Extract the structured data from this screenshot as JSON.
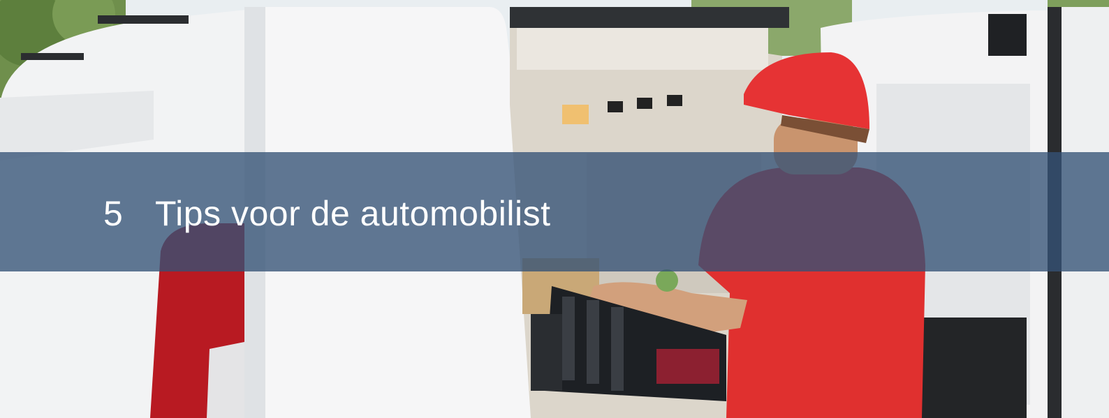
{
  "section": {
    "number": "5",
    "title": "Tips voor de automobilist"
  },
  "photo": {
    "subject": "delivery-van-loading",
    "banner_color": "#345276"
  }
}
